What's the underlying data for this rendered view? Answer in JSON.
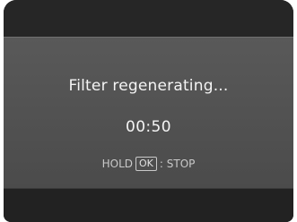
{
  "dialog": {
    "title": "Filter regenerating...",
    "timer": "00:50",
    "hint_hold": "HOLD",
    "hint_key": "OK",
    "hint_action": ": STOP"
  },
  "colors": {
    "dialog_bg": "#555555",
    "screen_bg": "#262626",
    "text_primary": "#f4f4f4",
    "text_secondary": "#c9c9c9"
  }
}
